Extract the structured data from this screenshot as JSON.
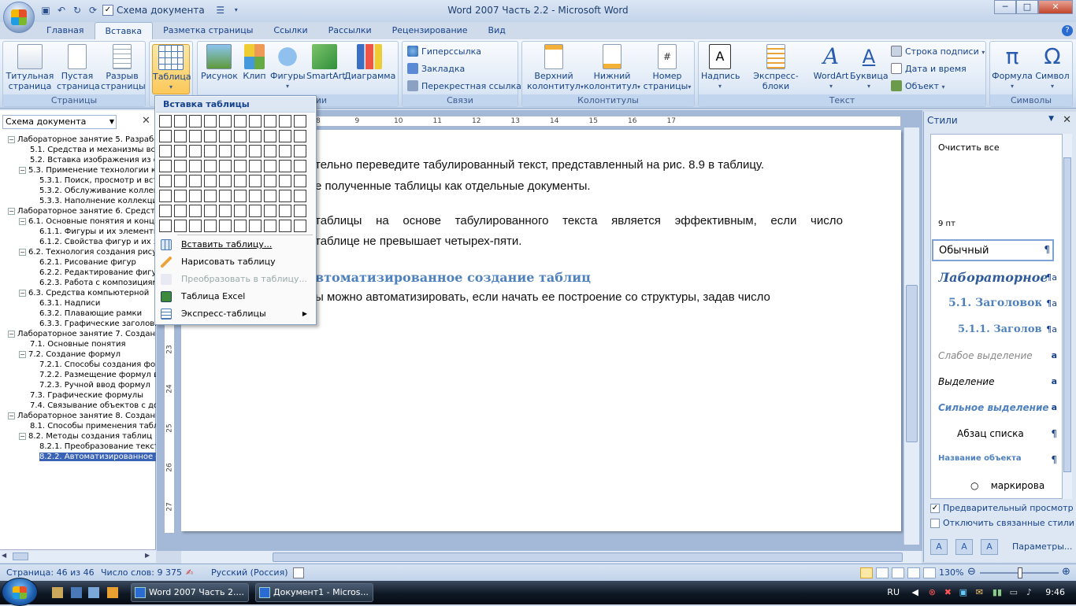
{
  "window": {
    "title": "Word 2007 Часть 2.2 - Microsoft Word",
    "qat_doc_map": "Схема документа",
    "controls": {
      "min": "─",
      "max": "□",
      "close": "✕"
    }
  },
  "tabs": [
    "Главная",
    "Вставка",
    "Разметка страницы",
    "Ссылки",
    "Рассылки",
    "Рецензирование",
    "Вид"
  ],
  "ribbon": {
    "pages": {
      "label": "Страницы",
      "title_page": [
        "Титульная",
        "страница"
      ],
      "blank_page": [
        "Пустая",
        "страница"
      ],
      "page_break": [
        "Разрыв",
        "страницы"
      ]
    },
    "tables": {
      "label": "Таблицы",
      "table": "Таблица"
    },
    "illustrations": {
      "label": "Иллюстрации",
      "label_visible": "ии",
      "picture": "Рисунок",
      "clip": "Клип",
      "shapes": "Фигуры",
      "smartart": "SmartArt",
      "chart": "Диаграмма"
    },
    "links": {
      "label": "Связи",
      "hyperlink": "Гиперссылка",
      "bookmark": "Закладка",
      "crossref": "Перекрестная ссылка"
    },
    "headers": {
      "label": "Колонтитулы",
      "header": [
        "Верхний",
        "колонтитул"
      ],
      "footer": [
        "Нижний",
        "колонтитул"
      ],
      "pagenum": [
        "Номер",
        "страницы"
      ]
    },
    "text": {
      "label": "Текст",
      "textbox": "Надпись",
      "quickparts": "Экспресс-блоки",
      "wordart": "WordArt",
      "dropcap": "Буквица",
      "signature": "Строка подписи",
      "datetime": "Дата и время",
      "object": "Объект"
    },
    "symbols": {
      "label": "Символы",
      "formula": "Формула",
      "symbol": "Символ",
      "pi": "π",
      "omega": "Ω"
    }
  },
  "table_menu": {
    "header": "Вставка таблицы",
    "items": [
      {
        "label": "Вставить таблицу...",
        "disabled": false
      },
      {
        "label": "Нарисовать таблицу",
        "disabled": false
      },
      {
        "label": "Преобразовать в таблицу...",
        "disabled": true
      },
      {
        "label": "Таблица Excel",
        "disabled": false
      },
      {
        "label": "Экспресс-таблицы",
        "disabled": false
      }
    ]
  },
  "nav": {
    "selector": "Схема документа",
    "items": [
      {
        "text": "Лабораторное занятие 5. Разрабо",
        "level": 0,
        "toggle": "−"
      },
      {
        "text": "5.1.  Средства и механизмы вс",
        "level": 2,
        "toggle": ""
      },
      {
        "text": "5.2.  Вставка изображения из ф",
        "level": 2,
        "toggle": ""
      },
      {
        "text": "5.3.  Применение технологии к",
        "level": 1,
        "toggle": "−"
      },
      {
        "text": "5.3.1. Поиск, просмотр и вст",
        "level": 3,
        "toggle": ""
      },
      {
        "text": "5.3.2. Обслуживание коллек",
        "level": 3,
        "toggle": ""
      },
      {
        "text": "5.3.3. Наполнение коллекци",
        "level": 3,
        "toggle": ""
      },
      {
        "text": "Лабораторное занятие 6. Средст",
        "level": 0,
        "toggle": "−"
      },
      {
        "text": "6.1. Основные понятия и конц",
        "level": 1,
        "toggle": "−"
      },
      {
        "text": "6.1.1. Фигуры и их элементы",
        "level": 3,
        "toggle": ""
      },
      {
        "text": "6.1.2. Свойства фигур и их з",
        "level": 3,
        "toggle": ""
      },
      {
        "text": "6.2. Технология создания рису",
        "level": 1,
        "toggle": "−"
      },
      {
        "text": "6.2.1. Рисование фигур",
        "level": 3,
        "toggle": ""
      },
      {
        "text": "6.2.2. Редактирование фигу",
        "level": 3,
        "toggle": ""
      },
      {
        "text": "6.2.3. Работа с композициям",
        "level": 3,
        "toggle": ""
      },
      {
        "text": "6.3.  Средства компьютерной",
        "level": 1,
        "toggle": "−"
      },
      {
        "text": "6.3.1. Надписи",
        "level": 3,
        "toggle": ""
      },
      {
        "text": "6.3.2. Плавающие рамки",
        "level": 3,
        "toggle": ""
      },
      {
        "text": "6.3.3. Графические заголовк",
        "level": 3,
        "toggle": ""
      },
      {
        "text": "Лабораторное занятие 7. Создани",
        "level": 0,
        "toggle": "−"
      },
      {
        "text": "7.1.  Основные понятия",
        "level": 2,
        "toggle": ""
      },
      {
        "text": "7.2. Создание формул",
        "level": 1,
        "toggle": "−"
      },
      {
        "text": "7.2.1. Способы создания форм",
        "level": 3,
        "toggle": ""
      },
      {
        "text": "7.2.2. Размещение формул в",
        "level": 3,
        "toggle": ""
      },
      {
        "text": "7.2.3. Ручной ввод формул",
        "level": 3,
        "toggle": ""
      },
      {
        "text": "7.3.  Графические формулы",
        "level": 2,
        "toggle": ""
      },
      {
        "text": "7.4. Связывание объектов с до",
        "level": 2,
        "toggle": ""
      },
      {
        "text": "Лабораторное занятие 8. Создани",
        "level": 0,
        "toggle": "−"
      },
      {
        "text": "8.1. Способы применения табли",
        "level": 2,
        "toggle": ""
      },
      {
        "text": "8.2. Методы создания таблиц",
        "level": 1,
        "toggle": "−"
      },
      {
        "text": "8.2.1. Преобразование текст",
        "level": 3,
        "toggle": ""
      },
      {
        "text": "8.2.2. Автоматизированное с",
        "level": 3,
        "toggle": "",
        "selected": true
      }
    ]
  },
  "ruler": {
    "ticks": [
      "8",
      "9",
      "10",
      "11",
      "12",
      "13",
      "14",
      "15",
      "16",
      "17"
    ]
  },
  "vruler": {
    "ticks": [
      "23",
      "24",
      "25",
      "26",
      "27"
    ]
  },
  "document": {
    "line1": "тельно переведите табулированный текст, представленный на рис. 8.9 в таблицу.",
    "line2": "е полученные таблицы как отдельные документы.",
    "line3": "таблицы на основе табулированного текста является эффективным, если число",
    "line4": "таблице не превышает четырех-пяти.",
    "heading": "втоматизированное создание таблиц",
    "line5": "ы можно автоматизировать, если начать ее построение со структуры, задав число"
  },
  "styles": {
    "title": "Стили",
    "clear": "Очистить все",
    "size": "9 пт",
    "items": [
      {
        "name": "Обычный",
        "mark": "¶"
      },
      {
        "name": "Лабораторное",
        "mark": "¶a"
      },
      {
        "name": "5.1.  Заголовок",
        "mark": "¶a"
      },
      {
        "name": "5.1.1.  Заголово",
        "mark": "¶a"
      },
      {
        "name": "Слабое выделение",
        "mark": "a"
      },
      {
        "name": "Выделение",
        "mark": "a"
      },
      {
        "name": "Сильное выделение",
        "mark": "a"
      },
      {
        "name": "Абзац списка",
        "mark": "¶"
      },
      {
        "name": "Название объекта",
        "mark": "¶"
      },
      {
        "name": "маркирова",
        "mark": ""
      }
    ],
    "preview": "Предварительный просмотр",
    "disable_linked": "Отключить связанные стили",
    "params": "Параметры..."
  },
  "status": {
    "page": "Страница: 46 из 46",
    "words": "Число слов: 9 375",
    "lang": "Русский (Россия)",
    "zoom": "130%"
  },
  "taskbar": {
    "btn1": "Word 2007 Часть 2....",
    "btn2": "Документ1 - Micros...",
    "lang": "RU",
    "time": "9:46"
  },
  "colors": {
    "ribbon_text": "#15428b",
    "heading": "#4f81bd",
    "selection": "#3a63b5"
  }
}
